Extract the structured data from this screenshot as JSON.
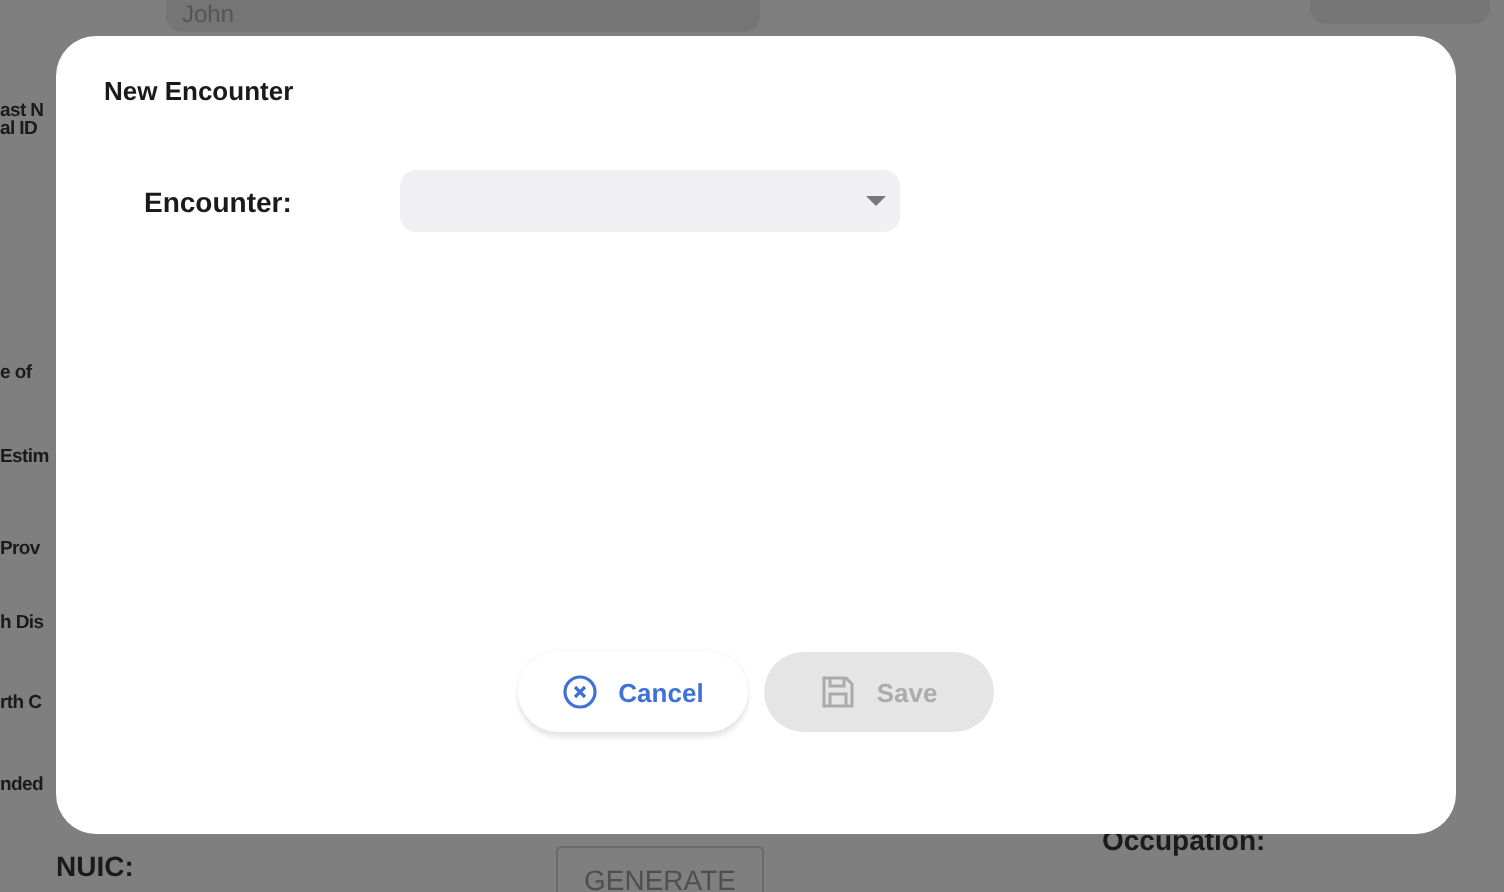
{
  "background": {
    "first_name_value": "John",
    "side_labels": [
      "ast N",
      "al ID",
      "e of",
      "Estim",
      "Prov",
      "h Dis",
      "rth C",
      "nded"
    ],
    "nuic_label": "NUIC:",
    "generate_button": "GENERATE",
    "occupation_label": "Occupation:"
  },
  "dialog": {
    "title": "New Encounter",
    "field": {
      "label": "Encounter:"
    },
    "buttons": [
      {
        "label": "Cancel",
        "kind": "cancel",
        "disabled": false
      },
      {
        "label": "Save",
        "kind": "save",
        "disabled": true
      }
    ]
  }
}
